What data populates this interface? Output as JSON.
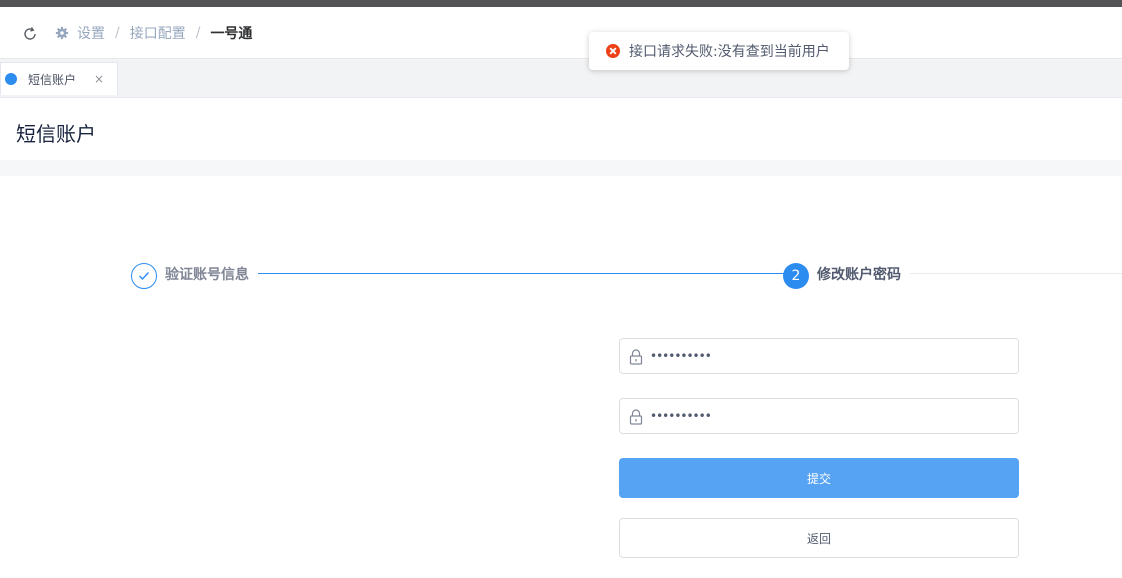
{
  "header": {
    "breadcrumb": [
      "设置",
      "接口配置",
      "一号通"
    ],
    "separator": "/"
  },
  "tags": [
    {
      "label": "短信账户",
      "close": "×"
    }
  ],
  "page": {
    "title": "短信账户"
  },
  "steps": [
    {
      "number": "✓",
      "title": "验证账号信息",
      "status": "finished"
    },
    {
      "number": "2",
      "title": "修改账户密码",
      "status": "process"
    }
  ],
  "form": {
    "password_value": "••••••••••",
    "confirm_value": "••••••••••",
    "submit_label": "提交",
    "back_label": "返回"
  },
  "toast": {
    "message": "接口请求失败:没有查到当前用户"
  },
  "colors": {
    "primary": "#2d8cf0",
    "error": "#ed4014",
    "button": "#57a3f3"
  }
}
